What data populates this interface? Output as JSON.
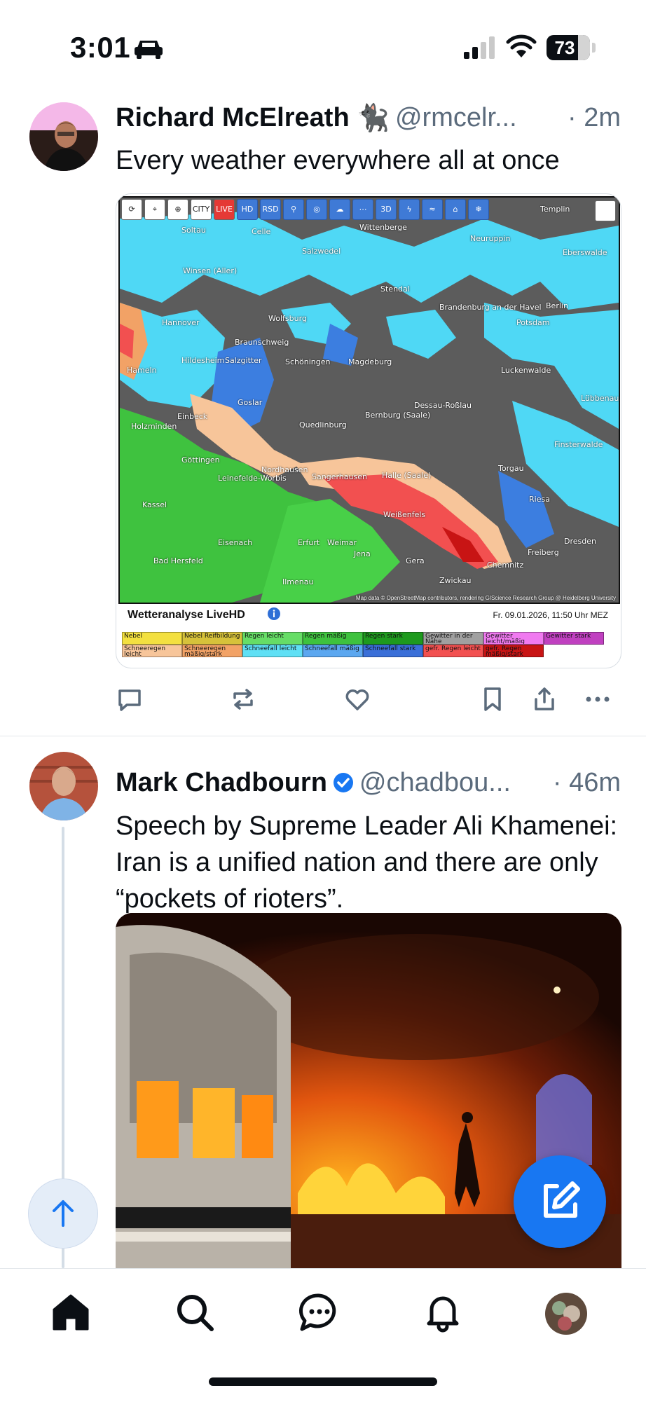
{
  "status_bar": {
    "time": "3:01",
    "battery": "73"
  },
  "posts": [
    {
      "author": "Richard McElreath",
      "author_emoji": "🐈‍⬛",
      "handle": "@rmcelr...",
      "timestamp": "· 2m",
      "text": "Every weather everywhere all at once",
      "map_embed": {
        "legend_title": "Wetteranalyse LiveHD",
        "date": "Fr. 09.01.2026, 11:50 Uhr MEZ",
        "credit": "Map data © OpenStreetMap contributors, rendering GIScience Research Group @ Heidelberg University",
        "toolbar": [
          "CITY",
          "LIVE",
          "HD",
          "RSD",
          "3D"
        ],
        "cities": [
          "Templin",
          "Soltau",
          "Celle",
          "Wittenberge",
          "Neuruppin",
          "Eberswalde",
          "Salzwedel",
          "Winsen (Aller)",
          "Stendal",
          "Berlin",
          "Brandenburg an der Havel",
          "Potsdam",
          "Hannover",
          "Wolfsburg",
          "Braunschweig",
          "Hildesheim",
          "Salzgitter",
          "Schöningen",
          "Magdeburg",
          "Hameln",
          "Luckenwalde",
          "Goslar",
          "Lübbenau (Spreewald)",
          "Dessau-Roßlau",
          "Holzminden",
          "Einbeck",
          "Bernburg (Saale)",
          "Quedlinburg",
          "Finsterwalde",
          "Göttingen",
          "Torgau",
          "Nordhausen",
          "Sangerhausen",
          "Halle (Saale)",
          "Leinefelde-Worbis",
          "Kassel",
          "Riesa",
          "Weißenfels",
          "Eisenach",
          "Erfurt",
          "Weimar",
          "Jena",
          "Dresden",
          "Freiberg",
          "Bad Hersfeld",
          "Gera",
          "Chemnitz",
          "Ilmenau",
          "Zwickau"
        ],
        "legend": [
          {
            "label": "Nebel",
            "color": "#f3e040"
          },
          {
            "label": "Nebel Reifbildung",
            "color": "#d6c23a"
          },
          {
            "label": "Regen leicht",
            "color": "#66dd66"
          },
          {
            "label": "Regen mäßig",
            "color": "#3ec23e"
          },
          {
            "label": "Regen stark",
            "color": "#1e9a1e"
          },
          {
            "label": "Gewitter in der Nähe",
            "color": "#a0a0a0"
          },
          {
            "label": "Gewitter leicht/mäßig",
            "color": "#f07af0"
          },
          {
            "label": "Gewitter stark",
            "color": "#c040c0"
          },
          {
            "label": "Schneeregen leicht",
            "color": "#f7c59a"
          },
          {
            "label": "Schneeregen mäßig/stark",
            "color": "#f2a266"
          },
          {
            "label": "Schneefall leicht",
            "color": "#5fe0f5"
          },
          {
            "label": "Schneefall mäßig",
            "color": "#5ba7f0"
          },
          {
            "label": "Schneefall stark",
            "color": "#3a6fd8"
          },
          {
            "label": "gefr. Regen leicht",
            "color": "#f25050"
          },
          {
            "label": "gefr. Regen mäßig/stark",
            "color": "#c81414"
          }
        ]
      }
    },
    {
      "author": "Mark Chadbourn",
      "handle": "@chadbou...",
      "timestamp": "· 46m",
      "text": "Speech by Supreme Leader Ali Khamenei: Iran is a unified nation and there are only “pockets of rioters”."
    }
  ],
  "colors": {
    "accent": "#1877f2",
    "muted": "#5b6b7c",
    "divider": "#e3e7eb",
    "verified": "#1877f2"
  },
  "icons": [
    "reply-icon",
    "repost-icon",
    "like-icon",
    "bookmark-icon",
    "share-icon",
    "more-icon",
    "home-icon",
    "search-icon",
    "chat-icon",
    "notifications-icon",
    "compose-icon",
    "arrow-up-icon"
  ]
}
